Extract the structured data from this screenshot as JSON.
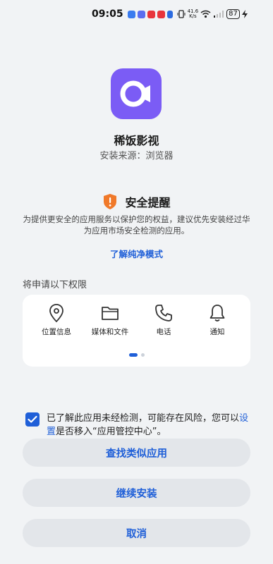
{
  "status_bar": {
    "time": "09:05",
    "net_speed_value": "41.6",
    "net_speed_unit": "K/s",
    "battery": "87"
  },
  "app": {
    "name": "稀饭影视",
    "source": "安装来源：浏览器",
    "icon_color": "#7b5cf5"
  },
  "security": {
    "title": "安全提醒",
    "description": "为提供更安全的应用服务以保护您的权益，建议优先安装经过华为应用市场安全检测的应用。",
    "link": "了解纯净模式",
    "shield_color": "#f0792a"
  },
  "permissions": {
    "heading": "将申请以下权限",
    "items": [
      {
        "label": "位置信息",
        "icon": "location-pin-icon"
      },
      {
        "label": "媒体和文件",
        "icon": "folder-icon"
      },
      {
        "label": "电话",
        "icon": "phone-icon"
      },
      {
        "label": "通知",
        "icon": "bell-icon"
      }
    ],
    "page": 1,
    "pages": 2
  },
  "acknowledge": {
    "checked": true,
    "text_before": "已了解此应用未经检测，可能存在风险，您可以",
    "link": "设置",
    "text_after": "是否移入“应用管控中心”。"
  },
  "buttons": {
    "find_similar": "查找类似应用",
    "continue": "继续安装",
    "cancel": "取消"
  },
  "colors": {
    "accent": "#1f5fd8",
    "background": "#f1f3f5"
  }
}
